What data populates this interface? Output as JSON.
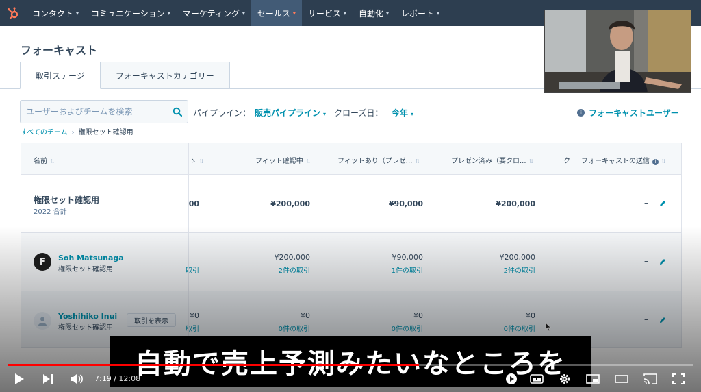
{
  "nav": {
    "items": [
      {
        "label": "コンタクト"
      },
      {
        "label": "コミュニケーション"
      },
      {
        "label": "マーケティング"
      },
      {
        "label": "セールス",
        "active": true
      },
      {
        "label": "サービス"
      },
      {
        "label": "自動化"
      },
      {
        "label": "レポート"
      }
    ]
  },
  "page": {
    "title": "フォーキャスト"
  },
  "tabs": [
    {
      "label": "取引ステージ",
      "active": true
    },
    {
      "label": "フォーキャストカテゴリー"
    }
  ],
  "filters": {
    "search_placeholder": "ユーザーおよびチームを検索",
    "pipeline_label": "パイプライン：",
    "pipeline_value": "販売パイプライン",
    "close_label": "クローズ日：",
    "close_value": "今年",
    "forecast_users": "フォーキャストユーザー"
  },
  "breadcrumb": {
    "root": "すべてのチーム",
    "current": "権限セット確認用"
  },
  "table": {
    "headers": {
      "name": "名前",
      "partial": "ゝ",
      "fit_checking": "フィット確認中",
      "fit_yes": "フィットあり（プレゼ...",
      "presented": "プレゼン済み（要クロ...",
      "partial2": "ク",
      "forecast_submit": "フォーキャストの送信"
    },
    "total_row": {
      "name": "権限セット確認用",
      "sub": "2022 合計",
      "partial_amount": "00",
      "fit_checking": "¥200,000",
      "fit_yes": "¥90,000",
      "presented": "¥200,000",
      "submit": "–"
    },
    "rows": [
      {
        "name": "Soh Matsunaga",
        "team": "権限セット確認用",
        "partial_deals": "取引",
        "fit_checking": "¥200,000",
        "fit_checking_deals": "2件の取引",
        "fit_yes": "¥90,000",
        "fit_yes_deals": "1件の取引",
        "presented": "¥200,000",
        "presented_deals": "2件の取引",
        "submit": "–"
      },
      {
        "name": "Yoshihiko Inui",
        "team": "権限セット確認用",
        "view_button": "取引を表示",
        "partial_amount": "¥0",
        "partial_deals": "取引",
        "fit_checking": "¥0",
        "fit_checking_deals": "0件の取引",
        "fit_yes": "¥0",
        "fit_yes_deals": "0件の取引",
        "presented": "¥0",
        "presented_deals": "0件の取引",
        "submit": "–"
      }
    ]
  },
  "video": {
    "subtitle": "自動で売上予測みたいなところを",
    "current_time": "7:19",
    "duration": "12:08",
    "progress_fraction": 0.6,
    "accent_color": "#ff0000"
  },
  "colors": {
    "nav_bg": "#2d3e50",
    "link": "#0091ae",
    "text": "#33475b",
    "brand": "#ff7a59"
  }
}
